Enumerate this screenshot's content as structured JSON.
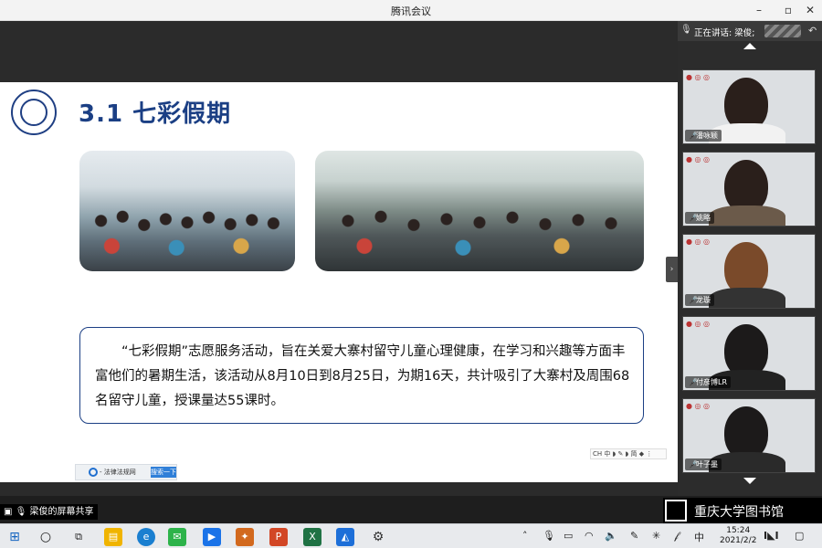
{
  "window": {
    "title": "腾讯会议"
  },
  "slide": {
    "title": "3.1  七彩假期",
    "paragraph": "“七彩假期”志愿服务活动，旨在关爱大寨村留守儿童心理健康，在学习和兴趣等方面丰富他们的暑期生活，该活动从8月10日到8月25日，为期16天，共计吸引了大寨村及周围68名留守儿童，授课量达55课时。",
    "tiny_toolbar": "CH 中 ◗ ✎ ◗ 简 ◆ ⋮",
    "browser_site": "- 法律法规网",
    "browser_go": "搜索一下"
  },
  "panel": {
    "speaking_label": "正在讲话: 梁俊;",
    "participants": [
      {
        "name": "潘咏颖"
      },
      {
        "name": "姚略"
      },
      {
        "name": "龙璇"
      },
      {
        "name": "付彦博LR"
      },
      {
        "name": "叶子墨"
      }
    ]
  },
  "share": {
    "text": "梁俊的屏幕共享"
  },
  "library": {
    "text": "重庆大学图书馆"
  },
  "taskbar": {
    "input_lang": "中",
    "time": "15:24",
    "date": "2021/2/2"
  },
  "colors": {
    "accent": "#1b3f84",
    "background": "#1e1e1e"
  }
}
